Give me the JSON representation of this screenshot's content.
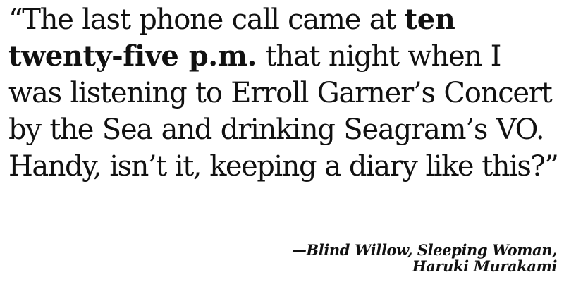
{
  "quote": {
    "line1_pre": "“The last phone call came at ",
    "line1_bold": "ten",
    "line2_bold": "twenty-five p.m.",
    "line2_post": " that night when I",
    "line3": "was listening to Erroll Garner’s Concert",
    "line4": "by the Sea and drinking Seagram’s VO.",
    "line5": "Handy, isn’t it, keeping a diary like this?”"
  },
  "attribution": {
    "line1": "—Blind Willow, Sleeping Woman,",
    "line2": "Haruki Murakami"
  }
}
